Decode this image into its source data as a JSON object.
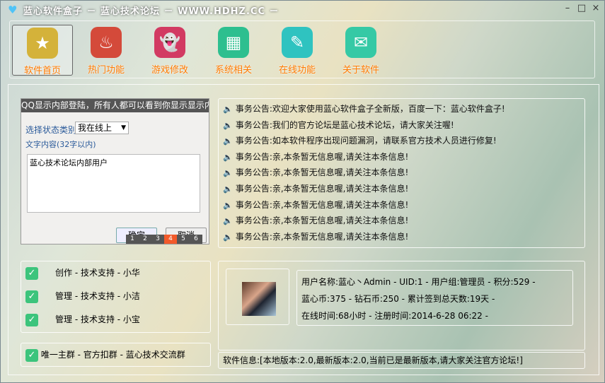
{
  "window": {
    "title": "蓝心软件盒子  －  蓝心技术论坛  －  WWW.HDHZ.CC  －",
    "controls": [
      "–",
      "□",
      "×"
    ]
  },
  "toolbar": [
    {
      "label": "软件首页",
      "icon": "star-icon",
      "color": "#d4b23a",
      "glyph": "★",
      "active": true
    },
    {
      "label": "热门功能",
      "icon": "fire-icon",
      "color": "#d44a3a",
      "glyph": "♨",
      "active": false
    },
    {
      "label": "游戏修改",
      "icon": "ghost-icon",
      "color": "#d23a62",
      "glyph": "👻",
      "active": false
    },
    {
      "label": "系统相关",
      "icon": "grid-icon",
      "color": "#2dbf8f",
      "glyph": "▦",
      "active": false
    },
    {
      "label": "在线功能",
      "icon": "popsicle-icon",
      "color": "#2fc3c0",
      "glyph": "✎",
      "active": false
    },
    {
      "label": "关于软件",
      "icon": "mail-icon",
      "color": "#35c9a5",
      "glyph": "✉",
      "active": false
    }
  ],
  "dialog": {
    "title": "QQ显示内部登陆，所有人都可以看到你显示显示内",
    "status_label": "选择状态类别",
    "status_value": "我在线上",
    "content_label": "文字内容(32字以内)",
    "content_value": "蓝心技术论坛内部用户",
    "ok": "确定",
    "cancel": "取消",
    "pages": [
      "1",
      "2",
      "3",
      "4",
      "5",
      "6"
    ],
    "active_page": "4"
  },
  "announcements": [
    "事务公告:欢迎大家使用蓝心软件盒子全新版，百度一下：蓝心软件盒子!",
    "事务公告:我们的官方论坛是蓝心技术论坛，请大家关注喔!",
    "事务公告:如本软件程序出现问题漏洞，请联系官方技术人员进行修复!",
    "事务公告:亲,本条暂无信息喔,请关注本条信息!",
    "事务公告:亲,本条暂无信息喔,请关注本条信息!",
    "事务公告:亲,本条暂无信息喔,请关注本条信息!",
    "事务公告:亲,本条暂无信息喔,请关注本条信息!",
    "事务公告:亲,本条暂无信息喔,请关注本条信息!",
    "事务公告:亲,本条暂无信息喔,请关注本条信息!"
  ],
  "staff": [
    "创作 - 技术支持 - 小华",
    "管理 - 技术支持 - 小洁",
    "管理 - 技术支持 - 小宝"
  ],
  "group": "唯一主群 - 官方扣群 - 蓝心技术交流群",
  "user": {
    "line1": "用户名称:蓝心丶Admin - UID:1 - 用户组:管理员 - 积分:529 -",
    "line2": "蓝心币:375 - 钻石币:250 - 累计签到总天数:19天 -",
    "line3": "在线时间:68小时 - 注册时间:2014-6-28 06:22 -"
  },
  "software_info": "软件信息:[本地版本:2.0,最新版本:2.0,当前已是最新版本,请大家关注官方论坛!]"
}
